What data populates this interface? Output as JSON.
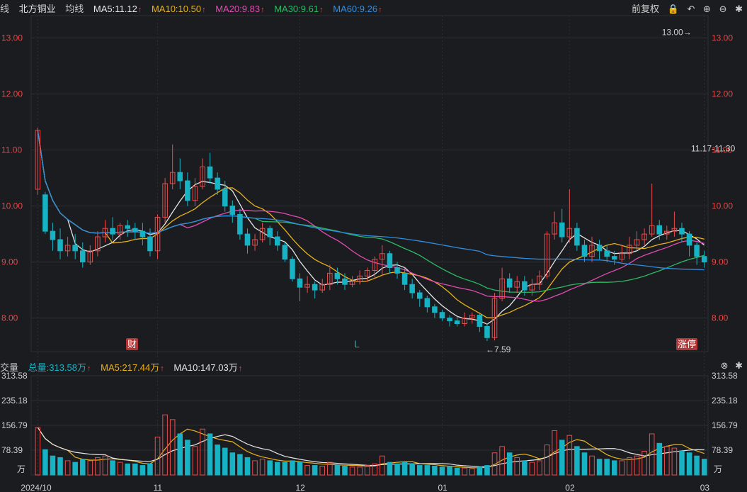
{
  "header": {
    "fragment": "线",
    "stock_name": "北方铜业",
    "indicator_label": "均线",
    "ma5": "MA5:11.12",
    "ma10": "MA10:10.50",
    "ma20": "MA20:9.83",
    "ma30": "MA30:9.61",
    "ma60": "MA60:9.26",
    "adjust_label": "前复权"
  },
  "volume_header": {
    "fragment": "交量",
    "total": "总量:313.58万",
    "ma5": "MA5:217.44万",
    "ma10": "MA10:147.03万"
  },
  "colors": {
    "background": "#1b1c20",
    "up": "#e84c4c",
    "down": "#17b3c4",
    "ma5": "#e6e6e6",
    "ma10": "#e9b21a",
    "ma20": "#e14bb1",
    "ma30": "#2bba64",
    "ma60": "#2f8de0",
    "grid": "#2c2e34",
    "axis_text": "#e24848"
  },
  "icons": [
    "lock-icon",
    "undo-icon",
    "zoom-in-icon",
    "zoom-out-icon",
    "settings-icon"
  ],
  "annotations": {
    "high_label": "13.00→",
    "low_label": "←7.59",
    "range_label": "11.17-11.30",
    "badge_cai": "财",
    "badge_l": "L",
    "badge_zhangting": "涨停"
  },
  "chart_data": {
    "type": "candlestick",
    "price_axis": {
      "ticks": [
        "13.00",
        "12.00",
        "11.00",
        "10.00",
        "9.00",
        "8.00"
      ],
      "range": [
        7.4,
        13.4
      ]
    },
    "volume_axis": {
      "ticks": [
        "313.58",
        "235.18",
        "156.79",
        "78.39"
      ],
      "unit": "万",
      "range": [
        0,
        313.58
      ]
    },
    "x_axis": {
      "labels": [
        "2024/10",
        "11",
        "12",
        "01",
        "02",
        "03"
      ],
      "label_index": [
        0,
        16,
        35,
        54,
        71,
        89
      ]
    },
    "candles": [
      [
        10.3,
        11.35,
        11.4,
        10.2,
        150
      ],
      [
        10.2,
        9.55,
        10.25,
        9.5,
        80
      ],
      [
        9.55,
        9.4,
        9.7,
        9.2,
        60
      ],
      [
        9.4,
        9.2,
        9.6,
        9.05,
        55
      ],
      [
        9.2,
        9.3,
        9.45,
        9.1,
        45
      ],
      [
        9.3,
        9.2,
        9.5,
        9.05,
        40
      ],
      [
        9.2,
        9.0,
        9.35,
        8.9,
        50
      ],
      [
        9.0,
        9.2,
        9.3,
        8.95,
        45
      ],
      [
        9.2,
        9.45,
        9.55,
        9.1,
        55
      ],
      [
        9.45,
        9.6,
        9.75,
        9.35,
        60
      ],
      [
        9.6,
        9.5,
        9.8,
        9.4,
        45
      ],
      [
        9.5,
        9.65,
        9.7,
        9.4,
        40
      ],
      [
        9.65,
        9.6,
        9.75,
        9.45,
        35
      ],
      [
        9.6,
        9.55,
        9.7,
        9.4,
        35
      ],
      [
        9.55,
        9.45,
        9.7,
        9.3,
        30
      ],
      [
        9.45,
        9.2,
        9.6,
        9.1,
        35
      ],
      [
        9.2,
        9.8,
        9.85,
        9.05,
        120
      ],
      [
        9.8,
        10.4,
        10.5,
        9.7,
        190
      ],
      [
        10.4,
        10.6,
        11.1,
        10.3,
        175
      ],
      [
        10.6,
        10.45,
        10.85,
        10.3,
        130
      ],
      [
        10.45,
        10.1,
        10.6,
        10.0,
        110
      ],
      [
        10.1,
        10.35,
        10.5,
        10.0,
        90
      ],
      [
        10.35,
        10.7,
        10.85,
        10.3,
        145
      ],
      [
        10.7,
        10.5,
        10.95,
        10.4,
        130
      ],
      [
        10.5,
        10.3,
        10.6,
        10.2,
        95
      ],
      [
        10.3,
        10.0,
        10.45,
        9.9,
        85
      ],
      [
        10.0,
        9.85,
        10.1,
        9.7,
        70
      ],
      [
        9.85,
        9.5,
        9.95,
        9.4,
        65
      ],
      [
        9.5,
        9.3,
        9.6,
        9.15,
        55
      ],
      [
        9.3,
        9.4,
        9.5,
        9.2,
        45
      ],
      [
        9.4,
        9.6,
        9.7,
        9.35,
        50
      ],
      [
        9.6,
        9.45,
        9.65,
        9.3,
        45
      ],
      [
        9.45,
        9.3,
        9.55,
        9.2,
        40
      ],
      [
        9.3,
        9.05,
        9.35,
        9.0,
        40
      ],
      [
        9.05,
        8.7,
        9.1,
        8.65,
        45
      ],
      [
        8.7,
        8.55,
        8.8,
        8.3,
        40
      ],
      [
        8.55,
        8.6,
        8.75,
        8.45,
        30
      ],
      [
        8.6,
        8.5,
        8.65,
        8.35,
        30
      ],
      [
        8.5,
        8.6,
        8.7,
        8.45,
        28
      ],
      [
        8.6,
        8.8,
        8.95,
        8.5,
        40
      ],
      [
        8.8,
        8.7,
        8.9,
        8.6,
        30
      ],
      [
        8.7,
        8.6,
        8.8,
        8.5,
        28
      ],
      [
        8.6,
        8.65,
        8.75,
        8.55,
        25
      ],
      [
        8.65,
        8.75,
        8.85,
        8.6,
        25
      ],
      [
        8.75,
        8.85,
        8.9,
        8.65,
        30
      ],
      [
        8.85,
        9.05,
        9.1,
        8.7,
        35
      ],
      [
        9.05,
        9.15,
        9.3,
        8.75,
        60
      ],
      [
        9.15,
        8.9,
        9.2,
        8.8,
        40
      ],
      [
        8.9,
        8.8,
        9.0,
        8.7,
        35
      ],
      [
        8.8,
        8.6,
        8.9,
        8.5,
        40
      ],
      [
        8.6,
        8.45,
        8.7,
        8.35,
        35
      ],
      [
        8.45,
        8.35,
        8.5,
        8.2,
        30
      ],
      [
        8.35,
        8.2,
        8.4,
        8.1,
        30
      ],
      [
        8.2,
        8.1,
        8.25,
        8.0,
        28
      ],
      [
        8.1,
        8.0,
        8.15,
        7.95,
        25
      ],
      [
        8.0,
        7.95,
        8.05,
        7.85,
        25
      ],
      [
        7.95,
        7.9,
        8.05,
        7.85,
        22
      ],
      [
        7.9,
        8.0,
        8.1,
        7.85,
        22
      ],
      [
        8.0,
        8.05,
        8.1,
        7.9,
        20
      ],
      [
        8.05,
        7.85,
        8.1,
        7.75,
        25
      ],
      [
        7.85,
        7.65,
        7.9,
        7.59,
        30
      ],
      [
        7.65,
        8.35,
        8.45,
        7.6,
        70
      ],
      [
        8.35,
        8.7,
        8.9,
        8.3,
        90
      ],
      [
        8.7,
        8.55,
        8.8,
        8.45,
        70
      ],
      [
        8.55,
        8.65,
        8.75,
        8.45,
        55
      ],
      [
        8.65,
        8.5,
        8.75,
        8.4,
        45
      ],
      [
        8.5,
        8.6,
        8.7,
        8.4,
        40
      ],
      [
        8.6,
        8.75,
        8.85,
        8.5,
        45
      ],
      [
        8.75,
        9.5,
        9.55,
        8.7,
        95
      ],
      [
        9.5,
        9.7,
        9.9,
        9.4,
        140
      ],
      [
        9.7,
        9.45,
        9.95,
        9.35,
        110
      ],
      [
        9.45,
        9.6,
        10.3,
        9.35,
        125
      ],
      [
        9.6,
        9.3,
        9.7,
        9.2,
        90
      ],
      [
        9.3,
        9.1,
        9.4,
        9.0,
        70
      ],
      [
        9.1,
        9.3,
        9.45,
        9.0,
        60
      ],
      [
        9.3,
        9.2,
        9.4,
        9.05,
        50
      ],
      [
        9.2,
        9.1,
        9.3,
        9.0,
        50
      ],
      [
        9.1,
        9.05,
        9.2,
        8.95,
        45
      ],
      [
        9.05,
        9.15,
        9.3,
        9.0,
        45
      ],
      [
        9.15,
        9.3,
        9.45,
        9.05,
        55
      ],
      [
        9.3,
        9.4,
        9.55,
        9.2,
        60
      ],
      [
        9.4,
        9.5,
        9.6,
        9.3,
        75
      ],
      [
        9.5,
        9.65,
        10.4,
        9.45,
        130
      ],
      [
        9.65,
        9.5,
        9.75,
        9.4,
        100
      ],
      [
        9.5,
        9.55,
        9.65,
        9.4,
        90
      ],
      [
        9.55,
        9.6,
        9.9,
        9.45,
        85
      ],
      [
        9.6,
        9.5,
        9.7,
        9.35,
        75
      ],
      [
        9.5,
        9.3,
        9.55,
        9.1,
        70
      ],
      [
        9.3,
        9.1,
        9.35,
        8.95,
        60
      ],
      [
        9.1,
        9.0,
        9.2,
        8.9,
        50
      ]
    ]
  }
}
